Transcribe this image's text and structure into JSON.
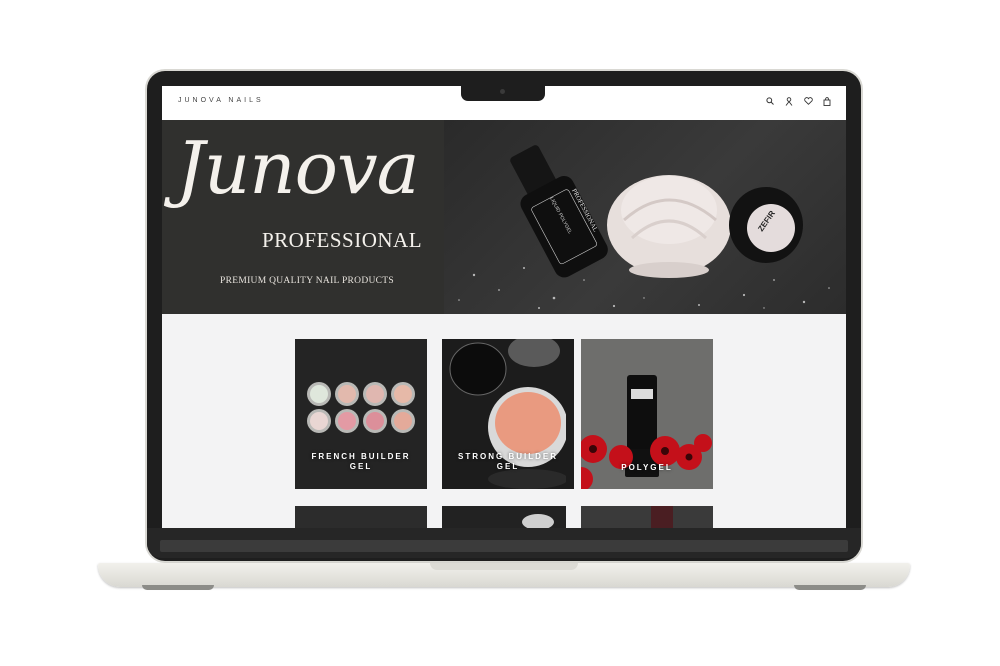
{
  "header": {
    "brand": "JUNOVA NAILS",
    "icons": [
      "search-icon",
      "account-icon",
      "wishlist-icon",
      "cart-icon"
    ]
  },
  "hero": {
    "logo_script": "Junova",
    "logo_word": "PROFESSIONAL",
    "tagline": "PREMIUM QUALITY NAIL PRODUCTS",
    "jar_label": "ZEFIR",
    "bottle_brand": "PROFESSIONAL",
    "bottle_label": "LIQUID POLYGEL"
  },
  "products": [
    {
      "label_line1": "FRENCH BUILDER",
      "label_line2": "GEL"
    },
    {
      "label_line1": "STRONG BUILDER",
      "label_line2": "GEL"
    },
    {
      "label_line1": "POLYGEL",
      "label_line2": ""
    }
  ],
  "colors": {
    "hero_dark": "#30302e",
    "page_bg": "#f3f3f4",
    "accent_text": "#f4f1ec"
  }
}
